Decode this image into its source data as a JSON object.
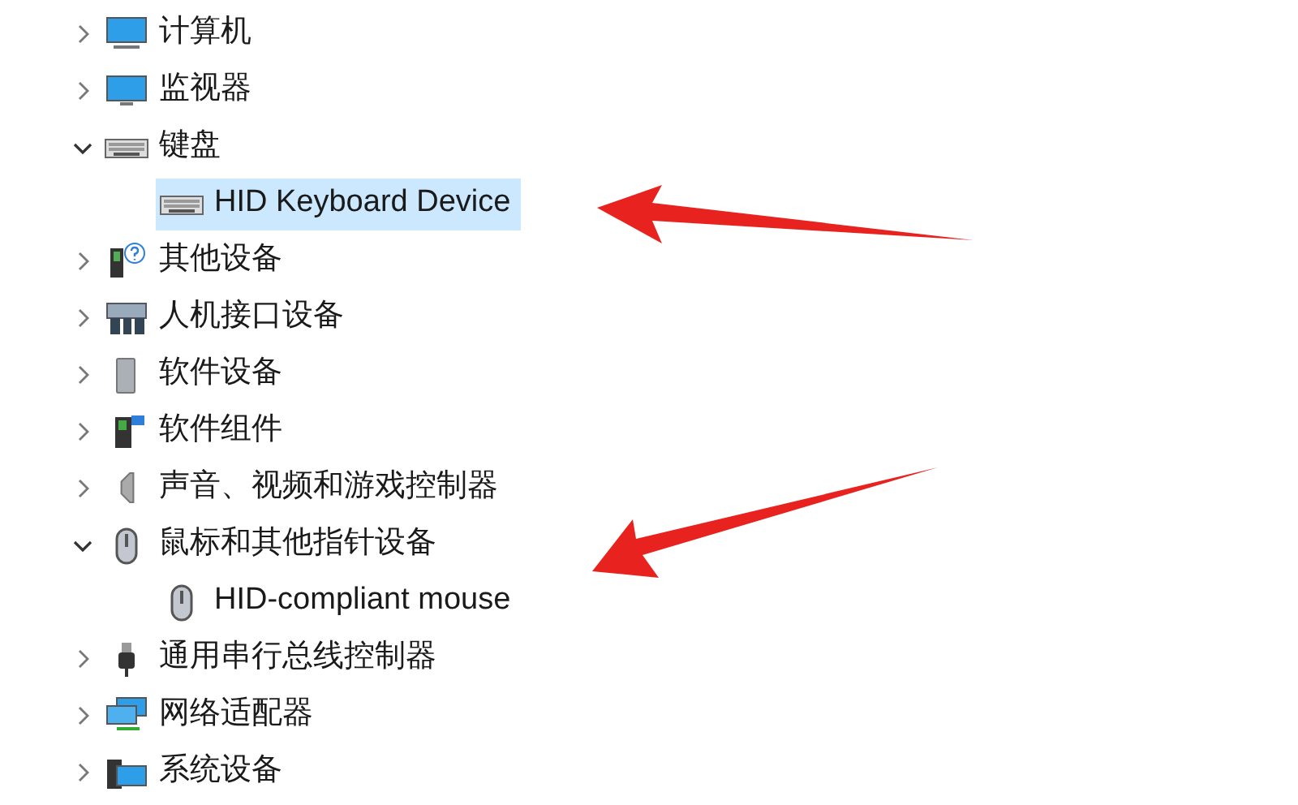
{
  "tree": [
    {
      "label": "计算机",
      "kind": "computer",
      "expanded": false,
      "selected": false
    },
    {
      "label": "监视器",
      "kind": "monitor",
      "expanded": false,
      "selected": false
    },
    {
      "label": "键盘",
      "kind": "keyboard",
      "expanded": true,
      "selected": false,
      "children": [
        {
          "label": "HID Keyboard Device",
          "kind": "keyboard",
          "selected": true
        }
      ]
    },
    {
      "label": "其他设备",
      "kind": "unknown",
      "expanded": false,
      "selected": false
    },
    {
      "label": "人机接口设备",
      "kind": "hid",
      "expanded": false,
      "selected": false
    },
    {
      "label": "软件设备",
      "kind": "tower",
      "expanded": false,
      "selected": false
    },
    {
      "label": "软件组件",
      "kind": "component",
      "expanded": false,
      "selected": false
    },
    {
      "label": "声音、视频和游戏控制器",
      "kind": "speaker",
      "expanded": false,
      "selected": false
    },
    {
      "label": "鼠标和其他指针设备",
      "kind": "mouse",
      "expanded": true,
      "selected": false,
      "children": [
        {
          "label": "HID-compliant mouse",
          "kind": "mouse",
          "selected": false
        }
      ]
    },
    {
      "label": "通用串行总线控制器",
      "kind": "usb",
      "expanded": false,
      "selected": false
    },
    {
      "label": "网络适配器",
      "kind": "network",
      "expanded": false,
      "selected": false
    },
    {
      "label": "系统设备",
      "kind": "system",
      "expanded": false,
      "selected": false
    }
  ]
}
